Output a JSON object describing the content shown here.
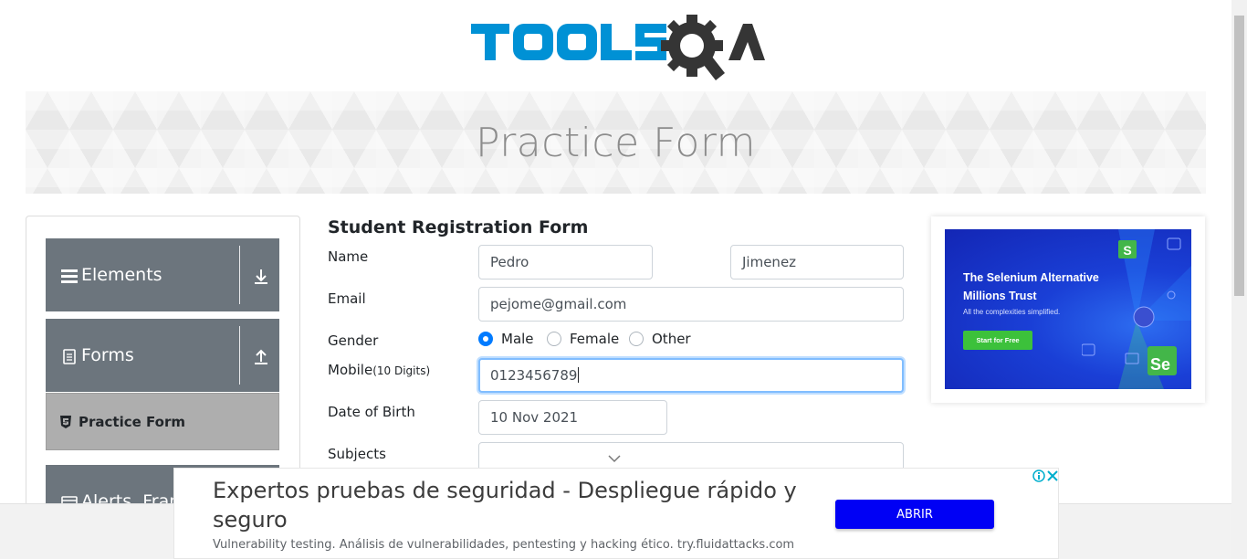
{
  "brand": {
    "logo_text": "TOOLSQA",
    "colors": {
      "tools_blue": "#0091d5",
      "qa_dark": "#353535"
    }
  },
  "banner": {
    "title": "Practice Form"
  },
  "sidebar": {
    "groups": [
      {
        "label": "Elements",
        "icon": "hamburger-icon",
        "arrow": "download-arrow-icon"
      },
      {
        "label": "Forms",
        "icon": "document-icon",
        "arrow": "upload-arrow-icon"
      },
      {
        "label": "Alerts, Frame",
        "icon": "window-icon"
      }
    ],
    "active_item": {
      "label": "Practice Form",
      "icon": "html5-icon"
    }
  },
  "form": {
    "title": "Student Registration Form",
    "name": {
      "label": "Name",
      "first": "Pedro",
      "last": "Jimenez"
    },
    "email": {
      "label": "Email",
      "value": "pejome@gmail.com"
    },
    "gender": {
      "label": "Gender",
      "options": [
        "Male",
        "Female",
        "Other"
      ],
      "selected": "Male"
    },
    "mobile": {
      "label": "Mobile",
      "hint": "(10 Digits)",
      "value": "0123456789"
    },
    "dob": {
      "label": "Date of Birth",
      "value": "10 Nov 2021"
    },
    "subjects": {
      "label": "Subjects",
      "value": ""
    }
  },
  "side_ad": {
    "headline_1": "The Selenium Alternative",
    "headline_2": "Millions Trust",
    "subtext": "All the complexities simplified.",
    "cta": "Start for Free"
  },
  "bottom_ad": {
    "headline": "Expertos pruebas de seguridad - Despliegue rápido y seguro",
    "description": "Vulnerability testing. Análisis de vulnerabilidades, pentesting y hacking ético. try.fluidattacks.com",
    "button": "ABRIR"
  }
}
